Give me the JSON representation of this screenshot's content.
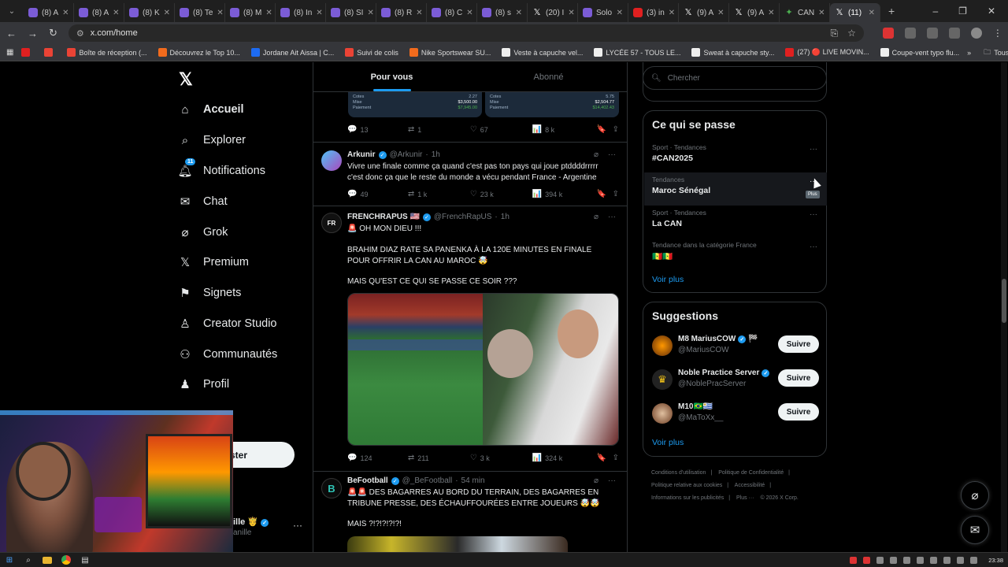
{
  "browser": {
    "tabs": [
      {
        "label": "(8) A",
        "icon": "twitch-icon"
      },
      {
        "label": "(8) A",
        "icon": "twitch-icon"
      },
      {
        "label": "(8) K",
        "icon": "twitch-icon"
      },
      {
        "label": "(8) Te",
        "icon": "twitch-icon"
      },
      {
        "label": "(8) M",
        "icon": "twitch-icon"
      },
      {
        "label": "(8) In",
        "icon": "twitch-icon"
      },
      {
        "label": "(8) SI",
        "icon": "twitch-icon"
      },
      {
        "label": "(8) R",
        "icon": "twitch-icon"
      },
      {
        "label": "(8) C",
        "icon": "twitch-icon"
      },
      {
        "label": "(8) s",
        "icon": "twitch-icon"
      },
      {
        "label": "(20) I",
        "icon": "x-icon"
      },
      {
        "label": "Solo",
        "icon": "twitch-icon"
      },
      {
        "label": "(3) in",
        "icon": "youtube-icon"
      },
      {
        "label": "(9) A",
        "icon": "x-icon"
      },
      {
        "label": "(9) A",
        "icon": "x-icon"
      },
      {
        "label": "CAN",
        "icon": "can-icon"
      },
      {
        "label": "(11)",
        "icon": "x-icon",
        "active": true
      }
    ],
    "url": "x.com/home",
    "bookmarks": [
      {
        "label": "",
        "icon": "youtube-icon"
      },
      {
        "label": "",
        "icon": "gmail-icon"
      },
      {
        "label": "Boîte de réception (...",
        "icon": "gmail-icon"
      },
      {
        "label": "Découvrez le Top 10...",
        "icon": "tl-icon"
      },
      {
        "label": "Jordane Ait Aissa | C...",
        "icon": "profile-icon"
      },
      {
        "label": "Suivi de colis",
        "icon": "flash-icon"
      },
      {
        "label": "Nike Sportswear SU...",
        "icon": "shop-icon"
      },
      {
        "label": "Veste à capuche vel...",
        "icon": "page-icon"
      },
      {
        "label": "LYCÉE 57 - TOUS LE...",
        "icon": "y-icon"
      },
      {
        "label": "Sweat à capuche sty...",
        "icon": "page-icon"
      },
      {
        "label": "(27) 🔴 LIVE MOVIN...",
        "icon": "youtube-icon"
      },
      {
        "label": "Coupe-vent typo flu...",
        "icon": "page-icon"
      }
    ],
    "all_bookmarks": "Tous les favoris"
  },
  "nav": {
    "items": [
      {
        "label": "Accueil",
        "icon": "home-icon",
        "bold": true
      },
      {
        "label": "Explorer",
        "icon": "search-icon"
      },
      {
        "label": "Notifications",
        "icon": "bell-icon",
        "badge": "11"
      },
      {
        "label": "Chat",
        "icon": "mail-icon"
      },
      {
        "label": "Grok",
        "icon": "grok-icon"
      },
      {
        "label": "Premium",
        "icon": "x-icon"
      },
      {
        "label": "Signets",
        "icon": "bookmark-icon"
      },
      {
        "label": "Creator Studio",
        "icon": "creator-icon"
      },
      {
        "label": "Communautés",
        "icon": "people-icon"
      },
      {
        "label": "Profil",
        "icon": "person-icon"
      }
    ],
    "post_button": "ster",
    "account": {
      "name": "ille 🤴",
      "handle": "anille"
    }
  },
  "feed": {
    "tabs": [
      {
        "label": "Pour vous",
        "active": true
      },
      {
        "label": "Abonné"
      }
    ],
    "bet_card": {
      "left": {
        "cotes_label": "Cotes",
        "cotes": "2.27",
        "mise_label": "Mise",
        "mise": "$3,500.00",
        "paiement_label": "Paiement",
        "paiement": "$7,945.00"
      },
      "right": {
        "cotes_label": "Cotes",
        "cotes": "5.75",
        "mise_label": "Mise",
        "mise": "$2,504.77",
        "paiement_label": "Paiement",
        "paiement": "$14,402.43"
      }
    },
    "first_actions": {
      "replies": "13",
      "reposts": "1",
      "likes": "67",
      "views": "8 k"
    },
    "tweets": [
      {
        "name": "Arkunir",
        "handle": "@Arkunir",
        "time": "1h",
        "text": "Vivre une finale comme ça quand c'est pas ton pays qui joue ptddddrrrrr c'est donc ça que le reste du monde a vécu pendant France - Argentine",
        "replies": "49",
        "reposts": "1 k",
        "likes": "23 k",
        "views": "394 k"
      },
      {
        "name": "FRENCHRAPUS",
        "flag": "🇺🇸",
        "handle": "@FrenchRapUS",
        "time": "1h",
        "line1": "🚨 OH MON DIEU !!!",
        "line2": "BRAHIM DIAZ RATE SA PANENKA À LA 120E MINUTES EN FINALE POUR OFFRIR LA CAN AU MAROC 🤯",
        "line3": "MAIS QU'EST CE QUI SE PASSE CE SOIR ???",
        "replies": "124",
        "reposts": "211",
        "likes": "3 k",
        "views": "324 k"
      },
      {
        "name": "BeFootball",
        "handle": "@_BeFootball",
        "time": "54 min",
        "line1": "🚨🚨 DES BAGARRES AU BORD DU TERRAIN, DES BAGARRES EN TRIBUNE PRESSE, DES ÉCHAUFFOURÉES ENTRE JOUEURS 🤯🤯",
        "line2": "MAIS ?!?!?!?!?!"
      }
    ]
  },
  "right": {
    "search_placeholder": "Chercher",
    "trending_title": "Ce qui se passe",
    "trends": [
      {
        "category": "Sport · Tendances",
        "title": "#CAN2025"
      },
      {
        "category": "Tendances",
        "title": "Maroc Sénégal"
      },
      {
        "category": "Sport · Tendances",
        "title": "La CAN"
      },
      {
        "category": "Tendance dans la catégorie France",
        "title": "🇸🇳🇸🇳"
      }
    ],
    "tooltip": "Plus",
    "see_more": "Voir plus",
    "suggestions_title": "Suggestions",
    "suggestions": [
      {
        "name": "M8 MariusCOW",
        "extra": "🏁",
        "handle": "@MariusCOW",
        "button": "Suivre"
      },
      {
        "name": "Noble Practice Server",
        "extra": "",
        "handle": "@NoblePracServer",
        "button": "Suivre"
      },
      {
        "name": "M10🇧🇷🇺🇾",
        "extra": "",
        "handle": "@MaToXx__",
        "button": "Suivre"
      }
    ],
    "see_more_2": "Voir plus",
    "footer": [
      "Conditions d'utilisation",
      "|",
      "Politique de Confidentialité",
      "|",
      "Politique relative aux cookies",
      "|",
      "Accessibilité",
      "|",
      "Informations sur les publicités",
      "|",
      "Plus ···",
      "© 2026 X Corp."
    ]
  },
  "taskbar": {
    "clock": "23:38"
  }
}
